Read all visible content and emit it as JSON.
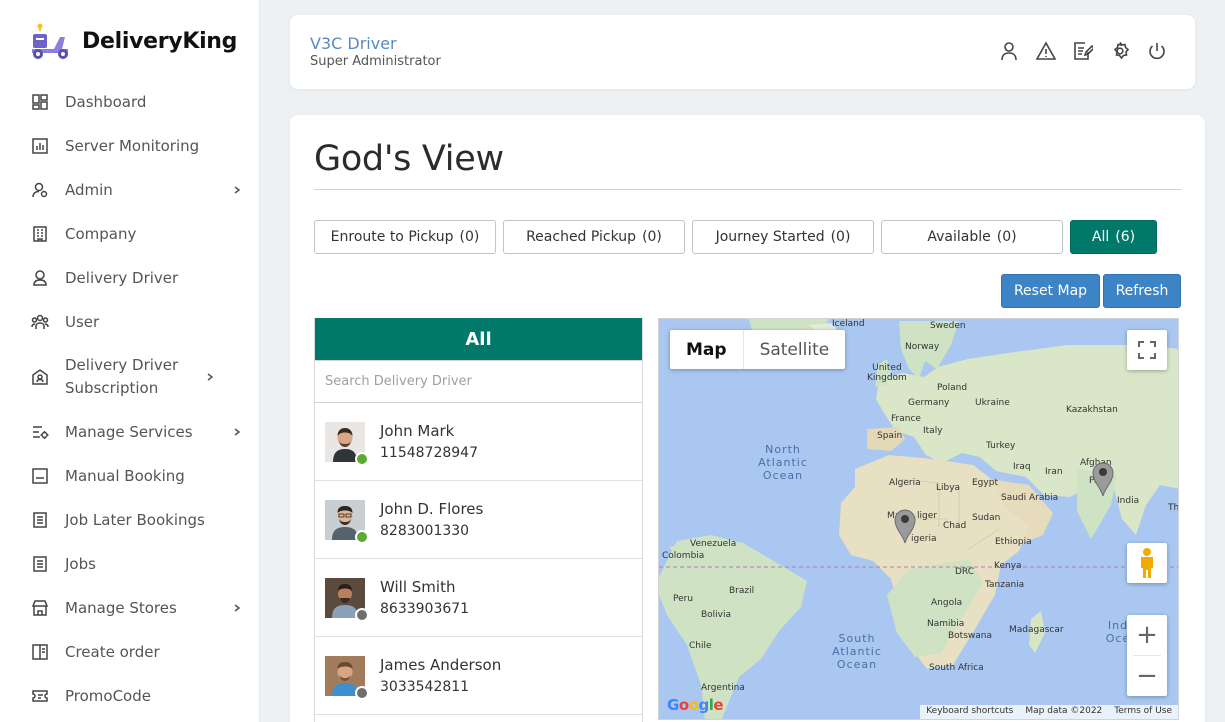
{
  "brand": {
    "name": "DeliveryKing"
  },
  "sidebar": {
    "items": [
      {
        "label": "Dashboard",
        "icon": "dashboard-icon",
        "chevron": false
      },
      {
        "label": "Server Monitoring",
        "icon": "chart-icon",
        "chevron": false
      },
      {
        "label": "Admin",
        "icon": "admin-user-icon",
        "chevron": true
      },
      {
        "label": "Company",
        "icon": "building-icon",
        "chevron": false
      },
      {
        "label": "Delivery Driver",
        "icon": "driver-icon",
        "chevron": false
      },
      {
        "label": "User",
        "icon": "users-icon",
        "chevron": false
      },
      {
        "label": "Delivery Driver Subscription",
        "icon": "subscription-icon",
        "chevron": true
      },
      {
        "label": "Manage Services",
        "icon": "services-icon",
        "chevron": true
      },
      {
        "label": "Manual Booking",
        "icon": "booking-icon",
        "chevron": false
      },
      {
        "label": "Job Later Bookings",
        "icon": "document-icon",
        "chevron": false
      },
      {
        "label": "Jobs",
        "icon": "document-icon",
        "chevron": false
      },
      {
        "label": "Manage Stores",
        "icon": "store-icon",
        "chevron": true
      },
      {
        "label": "Create order",
        "icon": "order-icon",
        "chevron": false
      },
      {
        "label": "PromoCode",
        "icon": "promo-icon",
        "chevron": false
      }
    ]
  },
  "header": {
    "title": "V3C Driver",
    "subtitle": "Super Administrator"
  },
  "main": {
    "title": "God's View",
    "filters": [
      {
        "label": "Enroute to Pickup",
        "count": "(0)"
      },
      {
        "label": "Reached Pickup",
        "count": "(0)"
      },
      {
        "label": "Journey Started",
        "count": "(0)"
      },
      {
        "label": "Available",
        "count": "(0)"
      },
      {
        "label": "All",
        "count": "(6)"
      }
    ],
    "reset_label": "Reset Map",
    "refresh_label": "Refresh"
  },
  "drivers": {
    "heading": "All",
    "search_placeholder": "Search Delivery Driver",
    "status_colors": {
      "online": "#5fa832",
      "offline": "#6e6e6e"
    },
    "list": [
      {
        "name": "John Mark",
        "phone": "11548728947",
        "status": "online"
      },
      {
        "name": "John D. Flores",
        "phone": "8283001330",
        "status": "online"
      },
      {
        "name": "Will Smith",
        "phone": "8633903671",
        "status": "offline"
      },
      {
        "name": "James Anderson",
        "phone": "3033542811",
        "status": "offline"
      }
    ]
  },
  "map": {
    "type_map": "Map",
    "type_satellite": "Satellite",
    "zoom_in": "+",
    "zoom_out": "−",
    "google": "Google",
    "attrib_shortcuts": "Keyboard shortcuts",
    "attrib_data": "Map data ©2022",
    "attrib_terms": "Terms of Use",
    "oceans": {
      "north_atlantic": "North\nAtlantic\nOcean",
      "south_atlantic": "South\nAtlantic\nOcean",
      "indian": "Ind\nOce"
    },
    "places": {
      "iceland": "Iceland",
      "sweden": "Sweden",
      "norway": "Norway",
      "uk": "United\nKingdom",
      "poland": "Poland",
      "germany": "Germany",
      "ukraine": "Ukraine",
      "france": "France",
      "kazakhstan": "Kazakhstan",
      "spain": "Spain",
      "italy": "Italy",
      "turkey": "Turkey",
      "iraq": "Iraq",
      "iran": "Iran",
      "afghanistan": "Afghan",
      "pakistan": "Paki",
      "algeria": "Algeria",
      "libya": "Libya",
      "egypt": "Egypt",
      "saudi": "Saudi Arabia",
      "india": "India",
      "mali": "Ma",
      "niger": "liger",
      "chad": "Chad",
      "sudan": "Sudan",
      "nigeria": "igeria",
      "ethiopia": "Ethiopia",
      "venezuela": "Venezuela",
      "colombia": "Colombia",
      "drc": "DRC",
      "kenya": "Kenya",
      "tanzania": "Tanzania",
      "peru": "Peru",
      "brazil": "Brazil",
      "angola": "Angola",
      "bolivia": "Bolivia",
      "namibia": "Namibia",
      "madagascar": "Madagascar",
      "botswana": "Botswana",
      "chile": "Chile",
      "south_africa": "South Africa",
      "argentina": "Argentina",
      "thailand": "Th"
    }
  }
}
